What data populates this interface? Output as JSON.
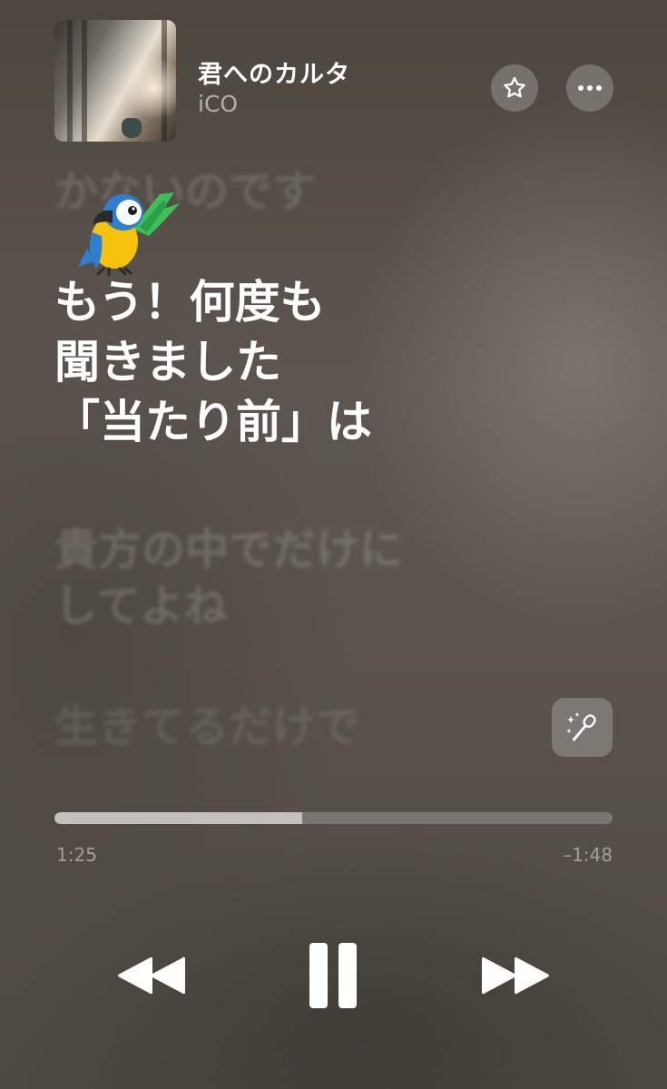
{
  "track": {
    "title": "君へのカルタ",
    "artist": "iCO"
  },
  "lyrics": {
    "previous": "かないのです",
    "current": [
      "もう！何度も",
      "聞きました",
      "「当たり前」は"
    ],
    "next": [
      "貴方の中でだけに",
      "してよね"
    ],
    "upcoming": "生きてるだけで"
  },
  "playback": {
    "elapsed": "1:25",
    "remaining": "–1:48",
    "progress_fraction": 0.444,
    "state": "playing"
  },
  "icons": {
    "favorite": "star-icon",
    "more": "ellipsis-icon",
    "sing": "microphone-sparkle-icon",
    "rewind": "rewind-icon",
    "pause": "pause-icon",
    "forward": "fast-forward-icon",
    "sticker": "parrot-sticker"
  },
  "colors": {
    "text_primary": "#ffffff",
    "parrot_yellow": "#f4c20d",
    "parrot_blue": "#2f7fd0",
    "parrot_green": "#3fbf5a"
  }
}
